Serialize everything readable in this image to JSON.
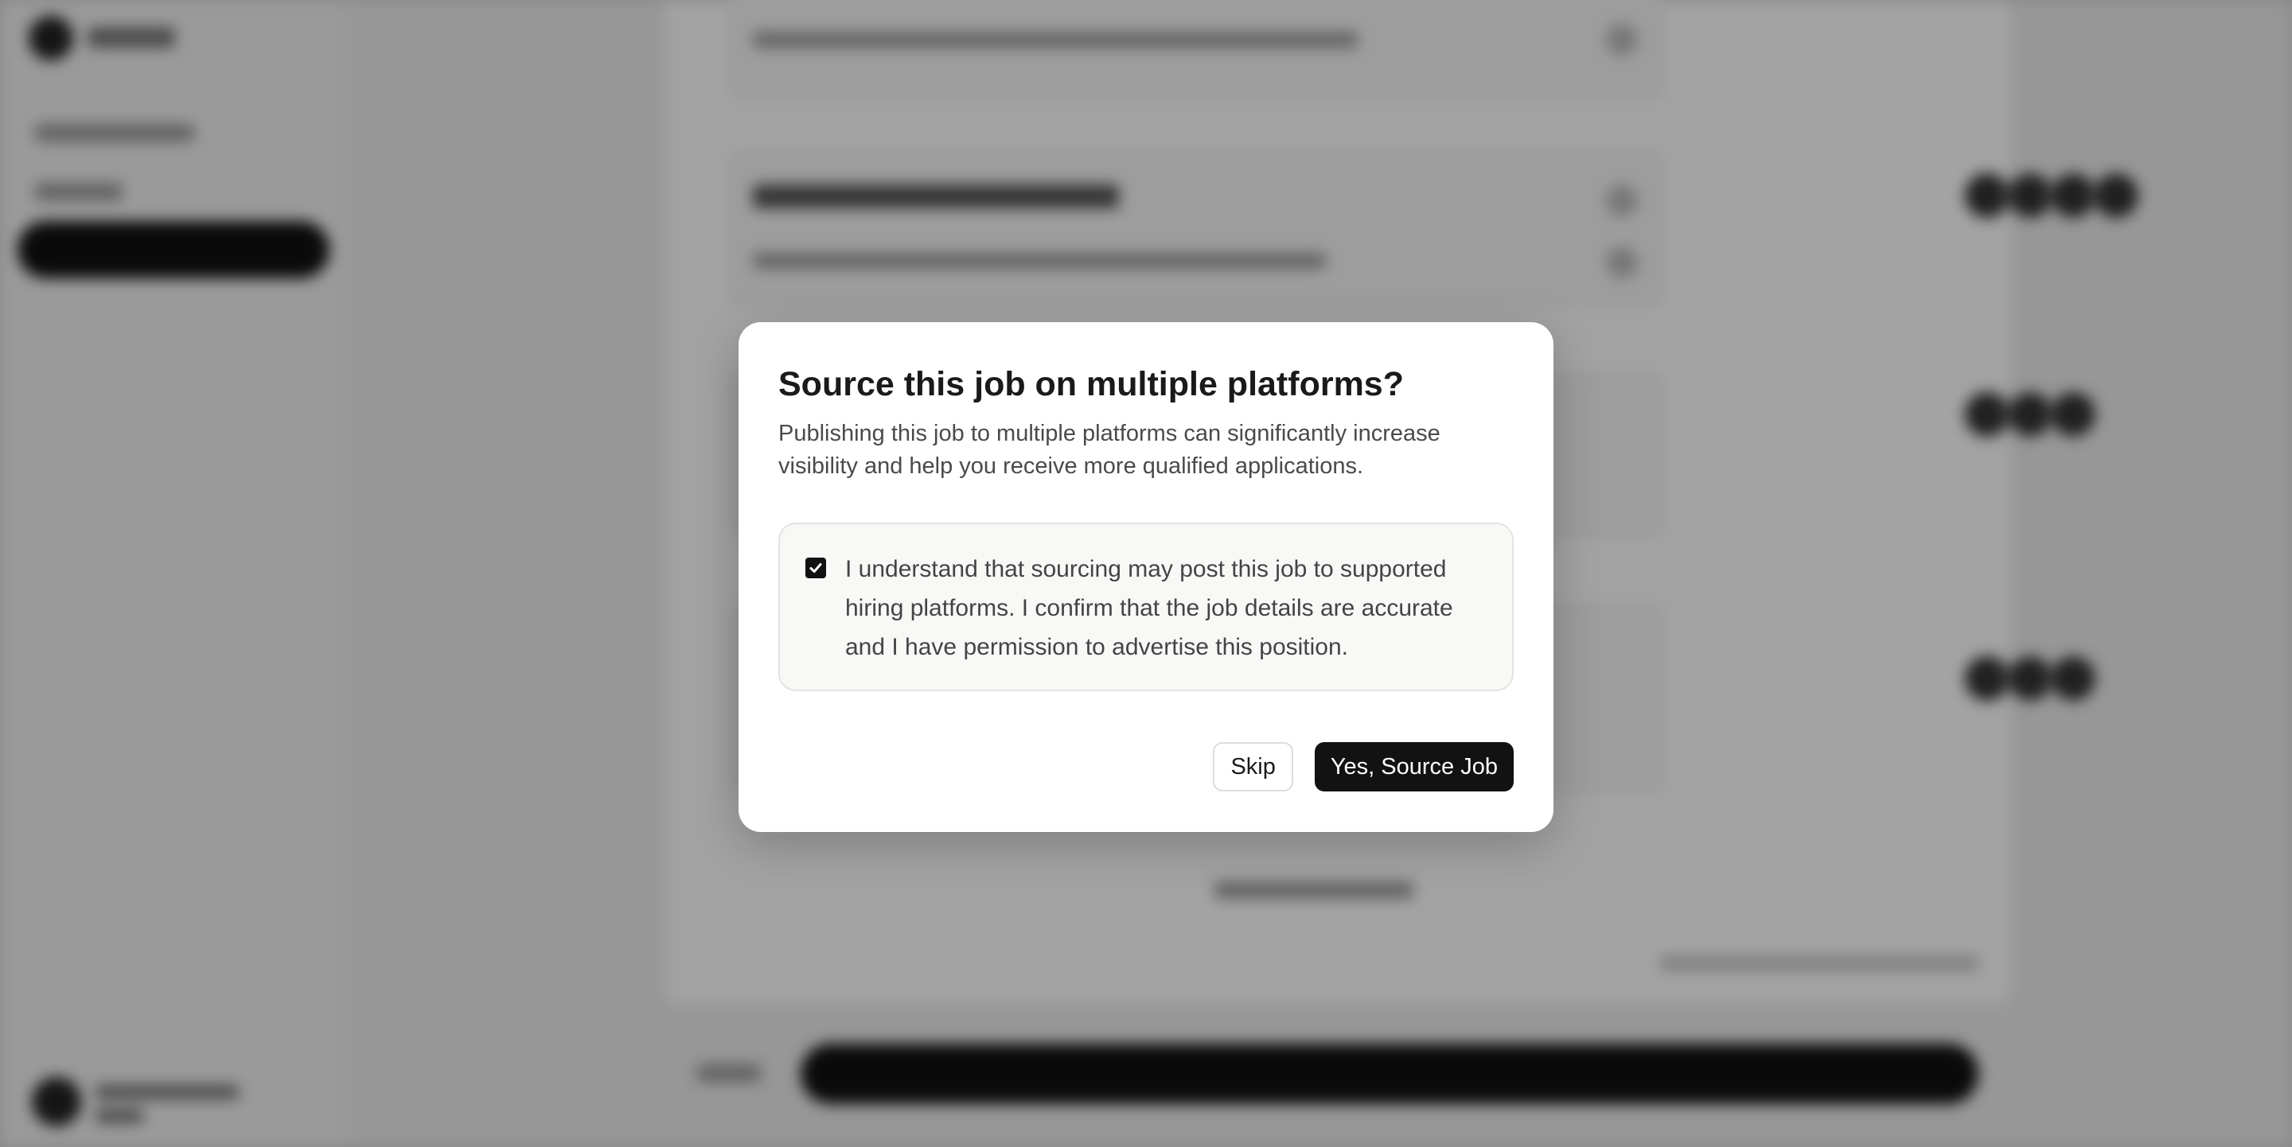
{
  "dialog": {
    "title": "Source this job on multiple platforms?",
    "description": "Publishing this job to multiple platforms can significantly increase visibility and help you receive more qualified applications.",
    "consent": {
      "checked": true,
      "text": "I understand that sourcing may post this job to supported hiring platforms. I confirm that the job details are accurate and I have permission to advertise this position."
    },
    "skip_label": "Skip",
    "confirm_label": "Yes, Source Job"
  },
  "colors": {
    "primary": "#121212",
    "overlay": "rgba(0,0,0,0.36)",
    "consent_bg": "#f8f8f6"
  }
}
